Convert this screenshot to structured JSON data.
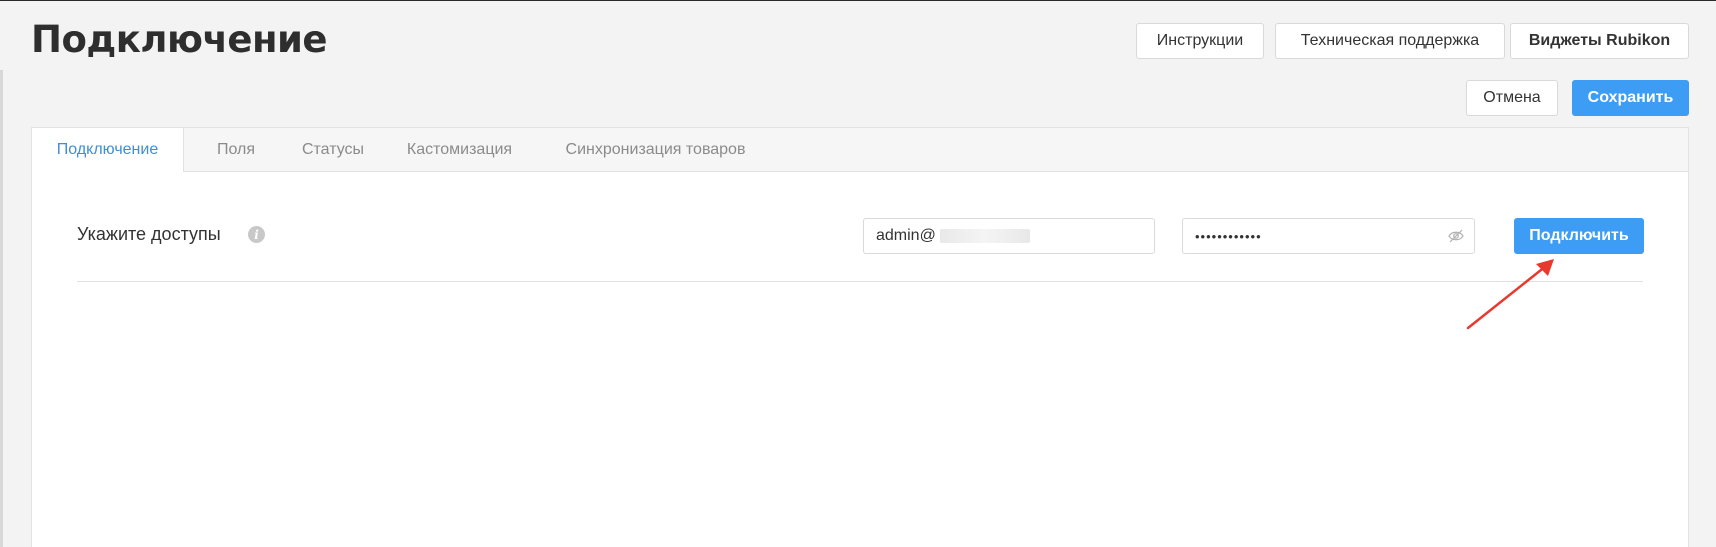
{
  "header": {
    "title": "Подключение",
    "buttons": {
      "instructions": "Инструкции",
      "support": "Техническая поддержка",
      "widgets": "Виджеты Rubikon",
      "cancel": "Отмена",
      "save": "Сохранить"
    }
  },
  "tabs": [
    {
      "label": "Подключение",
      "active": true
    },
    {
      "label": "Поля",
      "active": false
    },
    {
      "label": "Статусы",
      "active": false
    },
    {
      "label": "Кастомизация",
      "active": false
    },
    {
      "label": "Синхронизация товаров",
      "active": false
    }
  ],
  "connection": {
    "label": "Укажите доступы",
    "info_icon": "i",
    "login_value": "admin@",
    "password_value": "••••••••••••",
    "connect_button": "Подключить"
  },
  "colors": {
    "accent": "#3d9df5",
    "active_tab": "#3d8fd6",
    "annotation_arrow": "#e8392f"
  }
}
